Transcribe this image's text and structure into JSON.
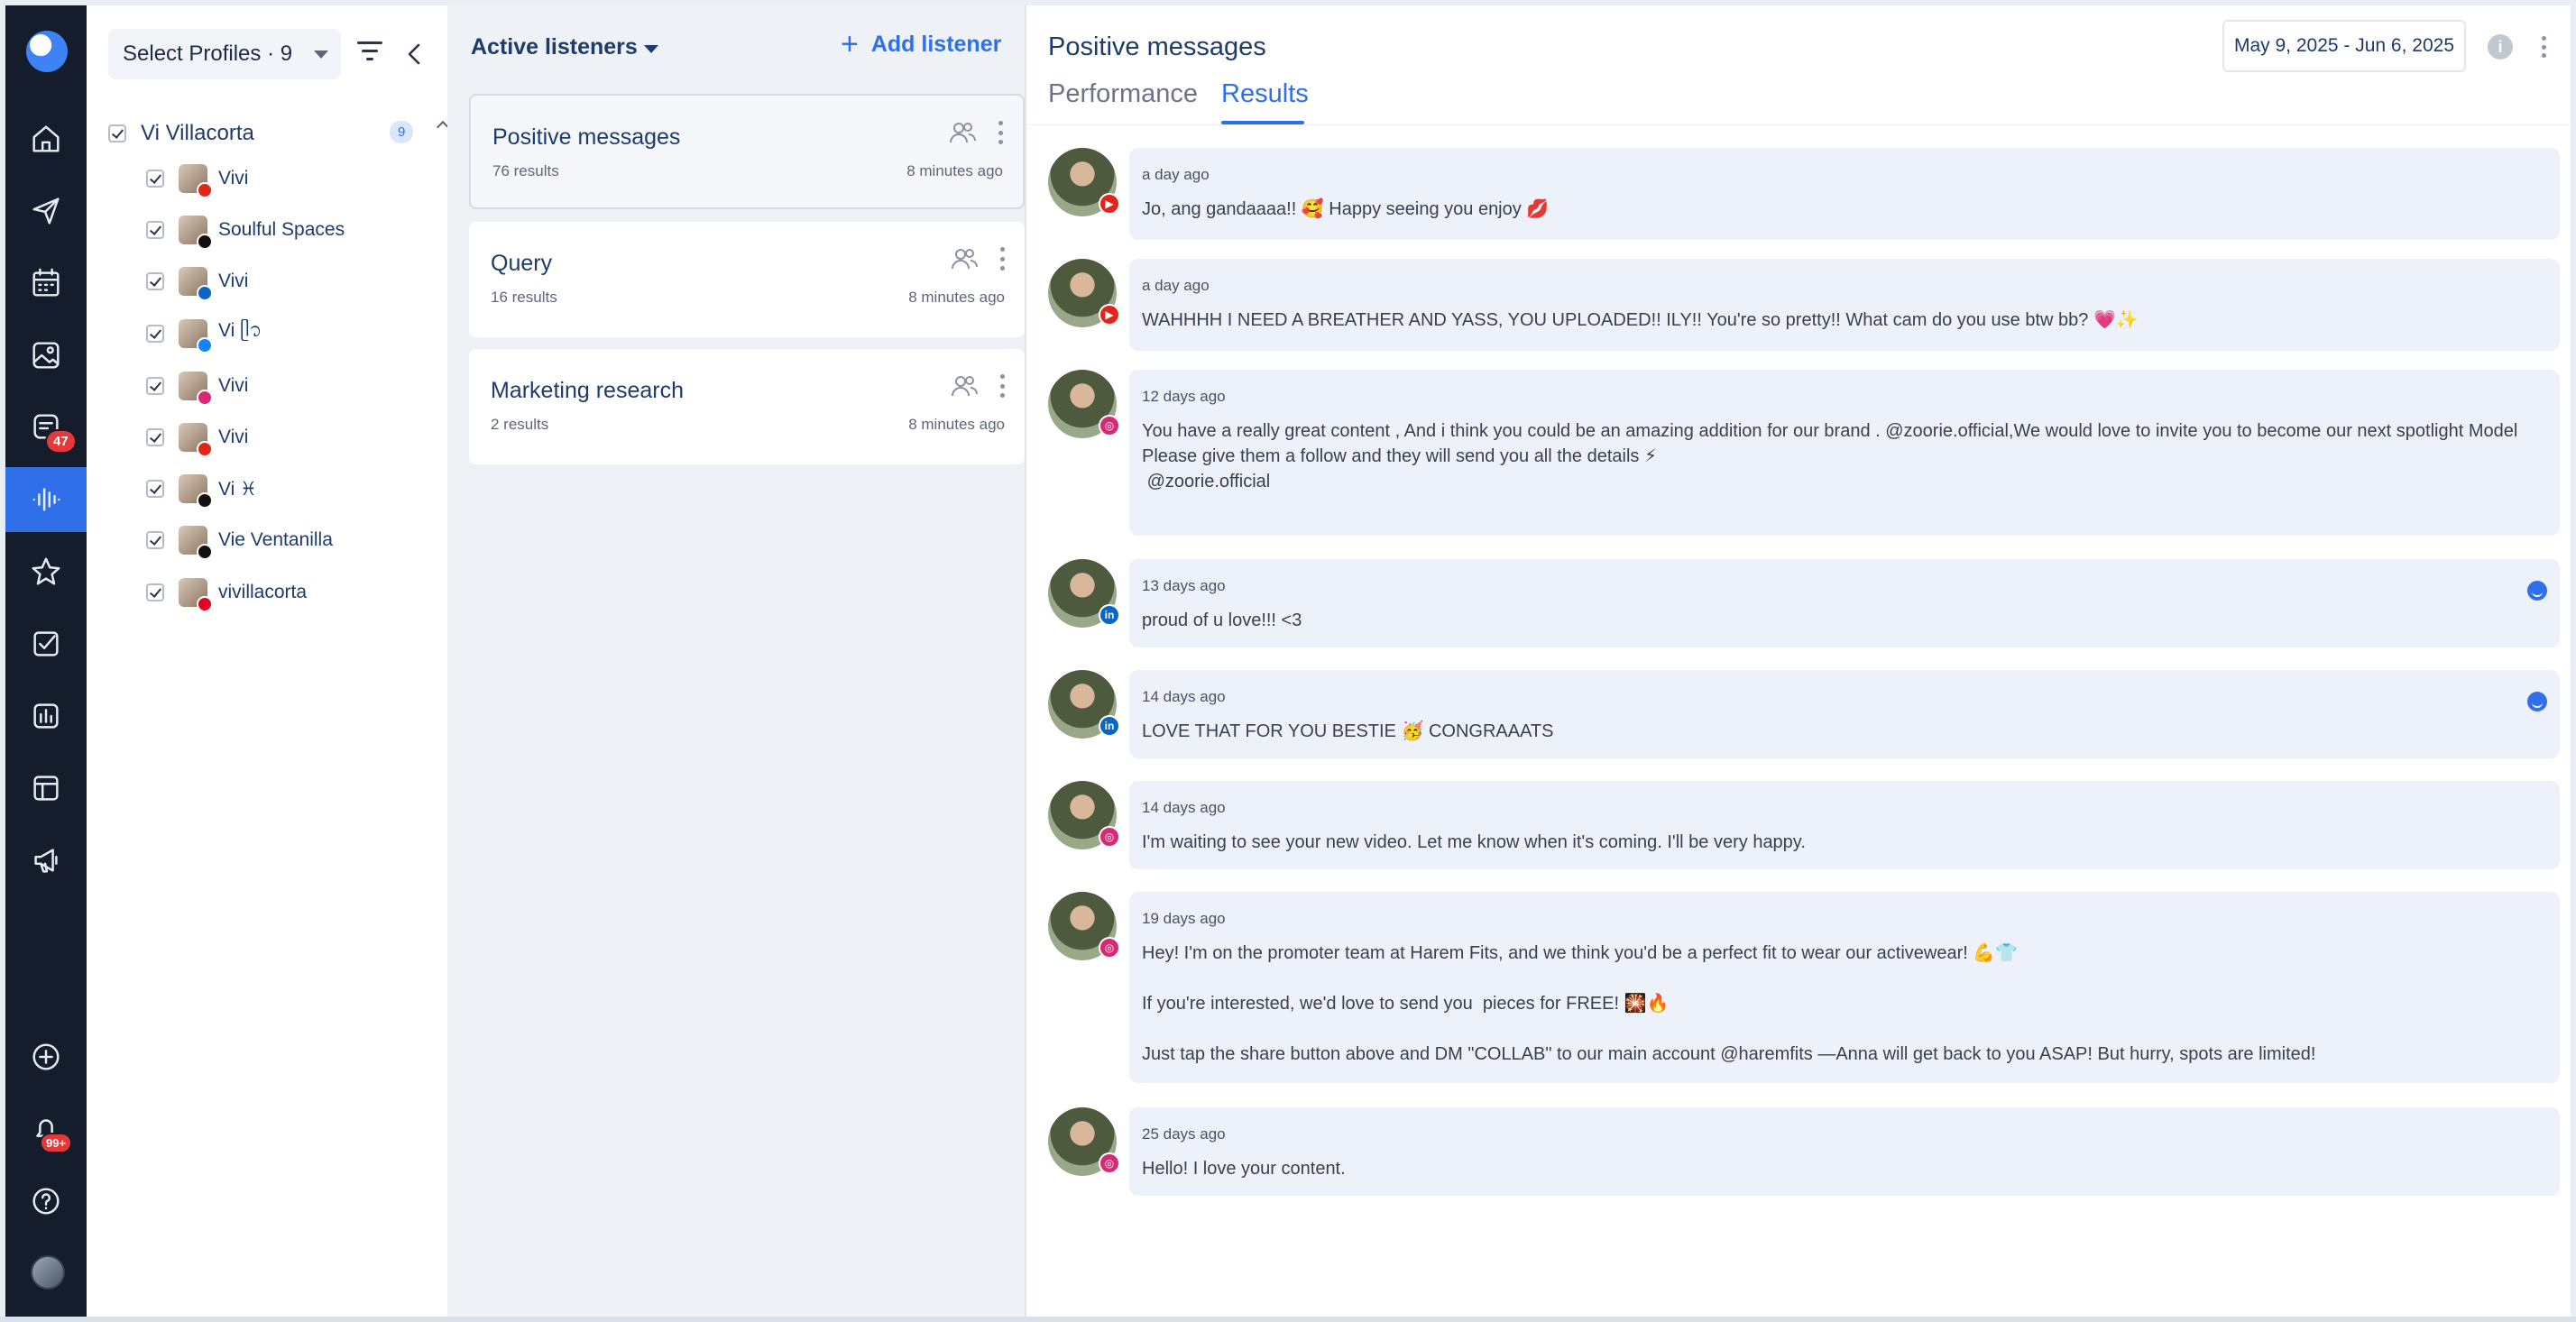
{
  "sidebar": {
    "items": [
      {
        "name": "home-icon"
      },
      {
        "name": "send-icon"
      },
      {
        "name": "calendar-icon"
      },
      {
        "name": "media-icon"
      },
      {
        "name": "inbox-icon",
        "badge": "47"
      },
      {
        "name": "listening-icon",
        "active": true
      },
      {
        "name": "star-icon"
      },
      {
        "name": "tasks-icon"
      },
      {
        "name": "analytics-icon"
      },
      {
        "name": "layout-icon"
      },
      {
        "name": "megaphone-icon"
      },
      {
        "name": "add-circle-icon"
      },
      {
        "name": "bell-icon",
        "badge": "99+"
      },
      {
        "name": "help-icon"
      }
    ]
  },
  "profiles": {
    "select_label": "Select Profiles · 9",
    "group": {
      "name": "Vi Villacorta",
      "count": "9"
    },
    "accounts": [
      {
        "name": "Vivi",
        "network": "youtube",
        "network_color": "#e1251b"
      },
      {
        "name": "Soulful Spaces",
        "network": "x",
        "network_color": "#111111"
      },
      {
        "name": "Vivi",
        "network": "linkedin",
        "network_color": "#0a66c2"
      },
      {
        "name": "Vi ᥫ᭡",
        "network": "bluesky",
        "network_color": "#1185fe"
      },
      {
        "name": "Vivi",
        "network": "instagram",
        "network_color": "#d62976"
      },
      {
        "name": "Vivi",
        "network": "youtube",
        "network_color": "#e1251b"
      },
      {
        "name": "Vi ♓︎",
        "network": "tiktok",
        "network_color": "#111111"
      },
      {
        "name": "Vie Ventanilla",
        "network": "threads",
        "network_color": "#111111"
      },
      {
        "name": "vivillacorta",
        "network": "pinterest",
        "network_color": "#e60023"
      }
    ]
  },
  "listeners": {
    "title": "Active listeners",
    "add_label": "Add listener",
    "cards": [
      {
        "title": "Positive messages",
        "results": "76 results",
        "time": "8 minutes ago",
        "selected": true
      },
      {
        "title": "Query",
        "results": "16 results",
        "time": "8 minutes ago",
        "selected": false
      },
      {
        "title": "Marketing research",
        "results": "2 results",
        "time": "8 minutes ago",
        "selected": false
      }
    ]
  },
  "results": {
    "title": "Positive messages",
    "date_range": "May 9, 2025 - Jun 6, 2025",
    "info_label": "i",
    "tabs": [
      "Performance",
      "Results"
    ],
    "active_tab": "Results",
    "messages": [
      {
        "time": "a day ago",
        "text": "Jo, ang gandaaaa!! 🥰 Happy seeing you enjoy 💋",
        "network": "youtube",
        "network_color": "#e1251b",
        "reaction": false
      },
      {
        "time": "a day ago",
        "text": "WAHHHH I NEED A BREATHER AND YASS, YOU UPLOADED!! ILY!! You're so pretty!! What cam do you use btw bb? 💗✨",
        "network": "youtube",
        "network_color": "#e1251b",
        "reaction": false
      },
      {
        "time": "12 days ago",
        "text": "You have a really great content , And i think you could be an amazing addition for our brand . @zoorie.official,We would love to invite you to become our next spotlight Model\nPlease give them a follow and they will send you all the details ⚡\n @zoorie.official",
        "network": "instagram",
        "network_color": "#d62976",
        "reaction": false
      },
      {
        "time": "13 days ago",
        "text": "proud of u love!!! <3",
        "network": "linkedin",
        "network_color": "#0a66c2",
        "reaction": true
      },
      {
        "time": "14 days ago",
        "text": "LOVE THAT FOR YOU BESTIE 🥳 CONGRAAATS",
        "network": "linkedin",
        "network_color": "#0a66c2",
        "reaction": true
      },
      {
        "time": "14 days ago",
        "text": "I'm waiting to see your new video. Let me know when it's coming. I'll be very happy.",
        "network": "instagram",
        "network_color": "#d62976",
        "reaction": false
      },
      {
        "time": "19 days ago",
        "text": "Hey! I'm on the promoter team at Harem Fits, and we think you'd be a perfect fit to wear our activewear! 💪👕\n\nIf you're interested, we'd love to send you  pieces for FREE! 🎇🔥\n\nJust tap the share button above and DM \"COLLAB\" to our main account @haremfits —Anna will get back to you ASAP! But hurry, spots are limited!",
        "network": "instagram",
        "network_color": "#d62976",
        "reaction": false
      },
      {
        "time": "25 days ago",
        "text": "Hello! I love your content.",
        "network": "instagram",
        "network_color": "#d62976",
        "reaction": false
      }
    ]
  }
}
